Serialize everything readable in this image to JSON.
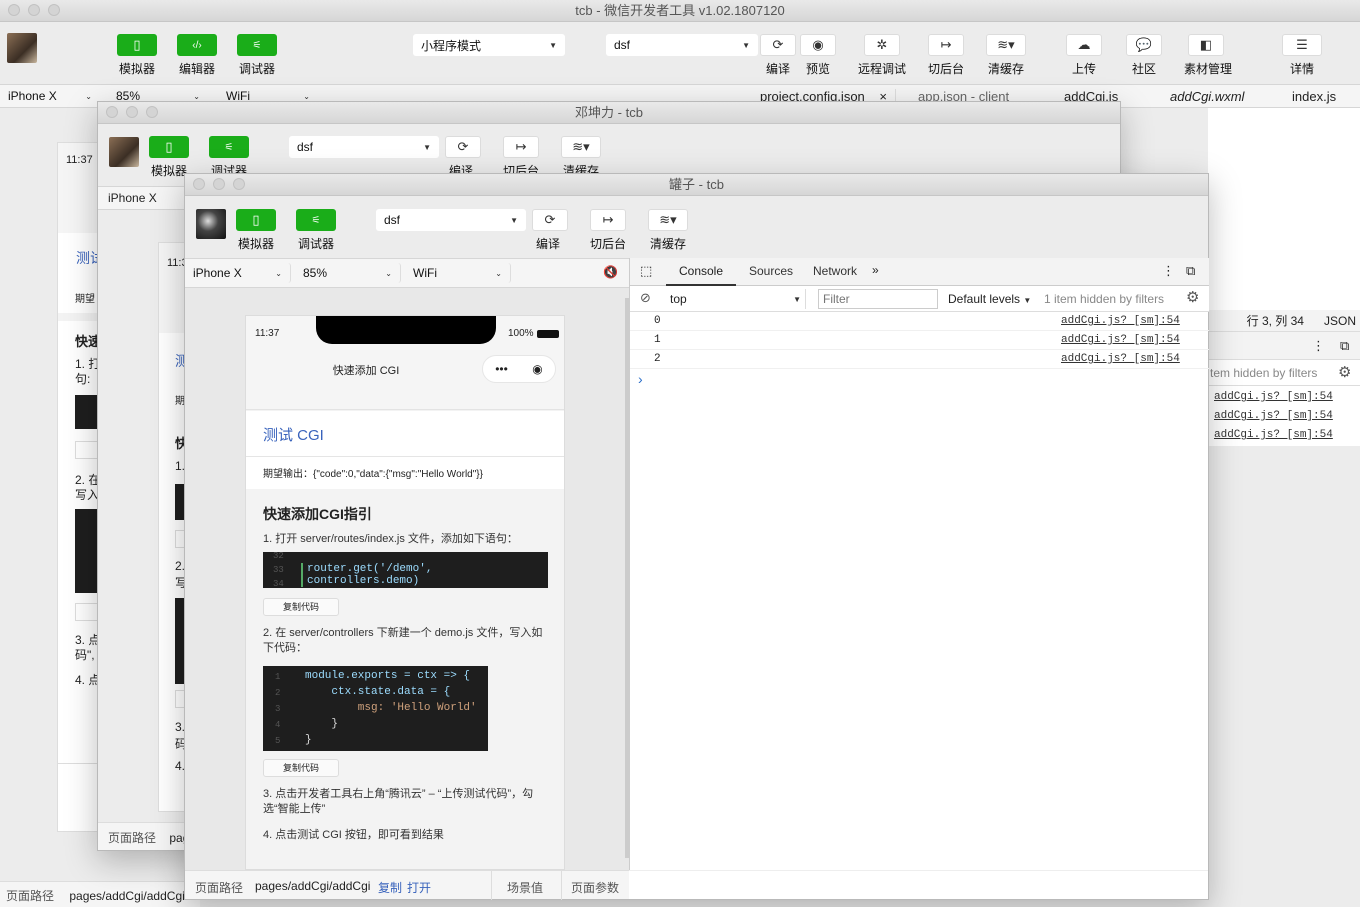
{
  "main": {
    "title": "tcb - 微信开发者工具 v1.02.1807120",
    "toolbar": {
      "simulator": "模拟器",
      "editor": "编辑器",
      "debugger": "调试器",
      "mode": "小程序模式",
      "project": "dsf",
      "compile": "编译",
      "preview": "预览",
      "remote_debug": "远程调试",
      "background": "切后台",
      "clear_cache": "清缓存",
      "upload": "上传",
      "community": "社区",
      "assets": "素材管理",
      "details": "详情"
    },
    "device": "iPhone X",
    "zoom": "85%",
    "network": "WiFi",
    "tabs": [
      "project.config.json",
      "app.json - client",
      "addCgi.js",
      "addCgi.wxml",
      "index.js"
    ],
    "status_position": "行 3, 列 34",
    "status_lang": "JSON",
    "page_path_label": "页面路径",
    "page_path": "pages/addCgi/addCgi",
    "console_hidden": "tem hidden by filters",
    "console_links": [
      "addCgi.js? [sm]:54",
      "addCgi.js? [sm]:54",
      "addCgi.js? [sm]:54"
    ]
  },
  "middle": {
    "title": "邓坤力 - tcb",
    "project": "dsf",
    "simulator": "模拟器",
    "debugger": "调试器",
    "compile": "编译",
    "background": "切后台",
    "clear_cache": "清缓存",
    "device": "iPhone X",
    "page_path_label": "页面路径",
    "page_path": "pag"
  },
  "back": {
    "time": "11:37",
    "test_label": "测试",
    "expect_label": "期望",
    "guide_label": "快速",
    "step1": "1. 打",
    "step1b": "句:",
    "step2": "2. 在",
    "step2b": "写入",
    "step3": "3. 点",
    "step3b": "码\",",
    "step4": "4. 点",
    "time2": "11:3",
    "test2": "测",
    "expect2": "期",
    "guide2": "快",
    "s1": "1.",
    "s2": "2.",
    "s2b": "写",
    "s3": "3.",
    "s3b": "码",
    "s4": "4."
  },
  "front": {
    "title": "罐子 - tcb",
    "project": "dsf",
    "simulator": "模拟器",
    "debugger": "调试器",
    "compile": "编译",
    "background": "切后台",
    "clear_cache": "清缓存",
    "device": "iPhone X",
    "zoom": "85%",
    "network": "WiFi",
    "phone": {
      "time": "11:37",
      "battery": "100%",
      "nav_title": "快速添加 CGI",
      "test_cgi": "测试 CGI",
      "expect_output": "期望输出：{\"code\":0,\"data\":{\"msg\":\"Hello World\"}}",
      "guide_title": "快速添加CGI指引",
      "step1": "1. 打开 server/routes/index.js 文件，添加如下语句：",
      "code1_lines": [
        "32",
        "33",
        "34"
      ],
      "code1": "router.get('/demo', controllers.demo)",
      "copy_code": "复制代码",
      "step2": "2. 在 server/controllers 下新建一个 demo.js 文件，写入如下代码：",
      "code2_line_numbers": [
        "1",
        "2",
        "3",
        "4",
        "5"
      ],
      "code2_lines": [
        "module.exports = ctx => {",
        "    ctx.state.data = {",
        "        msg: 'Hello World'",
        "    }",
        "}"
      ],
      "step3": "3. 点击开发者工具右上角“腾讯云” – “上传测试代码”，勾选“智能上传”",
      "step4": "4. 点击测试 CGI 按钮，即可看到结果"
    },
    "devtools": {
      "tabs": [
        "Console",
        "Sources",
        "Network"
      ],
      "context": "top",
      "filter_placeholder": "Filter",
      "levels": "Default levels",
      "hidden": "1 item hidden by filters",
      "logs": [
        {
          "value": "0",
          "source": "addCgi.js? [sm]:54"
        },
        {
          "value": "1",
          "source": "addCgi.js? [sm]:54"
        },
        {
          "value": "2",
          "source": "addCgi.js? [sm]:54"
        }
      ],
      "prompt": "›"
    },
    "footer": {
      "path_label": "页面路径",
      "path": "pages/addCgi/addCgi",
      "copy": "复制",
      "open": "打开",
      "scene": "场景值",
      "params": "页面参数"
    }
  },
  "colors": {
    "accent_green": "#1aad19",
    "link_blue": "#3963bc"
  }
}
